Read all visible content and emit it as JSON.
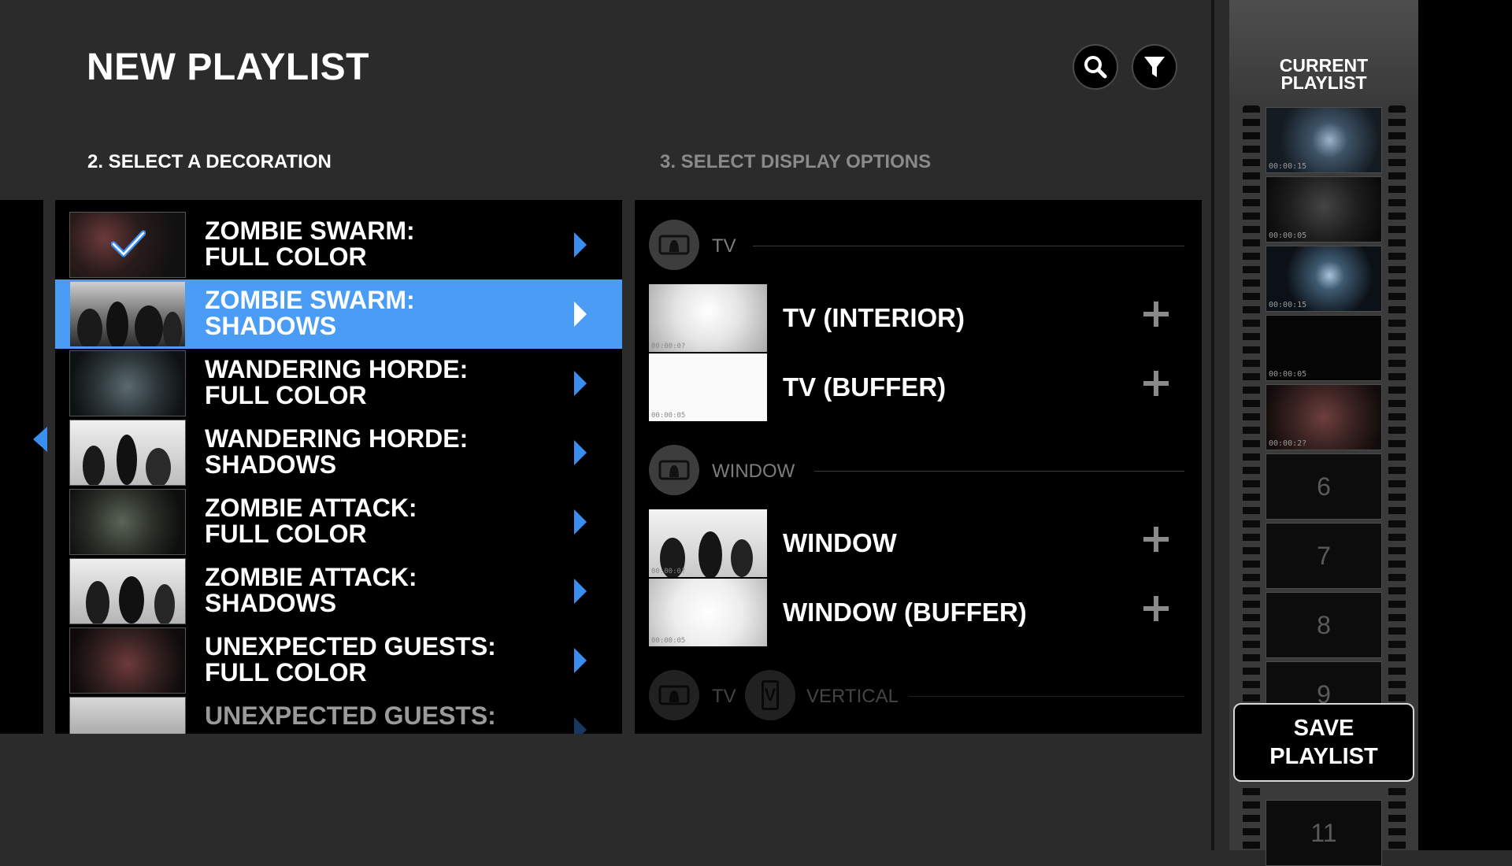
{
  "header": {
    "title": "NEW PLAYLIST",
    "search_icon": "search-icon",
    "filter_icon": "filter-icon"
  },
  "sections": {
    "decoration": "2. SELECT A DECORATION",
    "display_options": "3. SELECT DISPLAY OPTIONS"
  },
  "decorations": [
    {
      "line1": "ZOMBIE SWARM:",
      "line2": "FULL COLOR",
      "checked": true
    },
    {
      "line1": "ZOMBIE SWARM:",
      "line2": "SHADOWS",
      "selected": true
    },
    {
      "line1": "WANDERING HORDE:",
      "line2": "FULL COLOR"
    },
    {
      "line1": "WANDERING HORDE:",
      "line2": "SHADOWS"
    },
    {
      "line1": "ZOMBIE ATTACK:",
      "line2": "FULL COLOR"
    },
    {
      "line1": "ZOMBIE ATTACK:",
      "line2": "SHADOWS"
    },
    {
      "line1": "UNEXPECTED GUESTS:",
      "line2": "FULL COLOR"
    },
    {
      "line1": "UNEXPECTED GUESTS:",
      "line2": ""
    }
  ],
  "options": {
    "tv_group": "TV",
    "tv_items": [
      {
        "label": "TV (INTERIOR)",
        "time": "00:00:0?"
      },
      {
        "label": "TV (BUFFER)",
        "time": "00:00:05"
      }
    ],
    "window_group": "WINDOW",
    "window_items": [
      {
        "label": "WINDOW",
        "time": "00:00:0?"
      },
      {
        "label": "WINDOW (BUFFER)",
        "time": "00:00:05"
      }
    ],
    "tv_vertical_tv": "TV",
    "tv_vertical_v": "V",
    "tv_vertical_label": "VERTICAL"
  },
  "playlist": {
    "title_line1": "CURRENT",
    "title_line2": "PLAYLIST",
    "frames": [
      {
        "time": "00:00:15"
      },
      {
        "time": "00:00:05"
      },
      {
        "time": "00:00:15"
      },
      {
        "time": "00:00:05"
      },
      {
        "time": "00:00:2?"
      },
      {
        "num": "6"
      },
      {
        "num": "7"
      },
      {
        "num": "8"
      },
      {
        "num": "9"
      },
      {
        "num": "11"
      }
    ],
    "save_line1": "SAVE",
    "save_line2": "PLAYLIST"
  },
  "colors": {
    "accent": "#4a9cf5",
    "background": "#2b2b2b",
    "panel": "#000000"
  }
}
